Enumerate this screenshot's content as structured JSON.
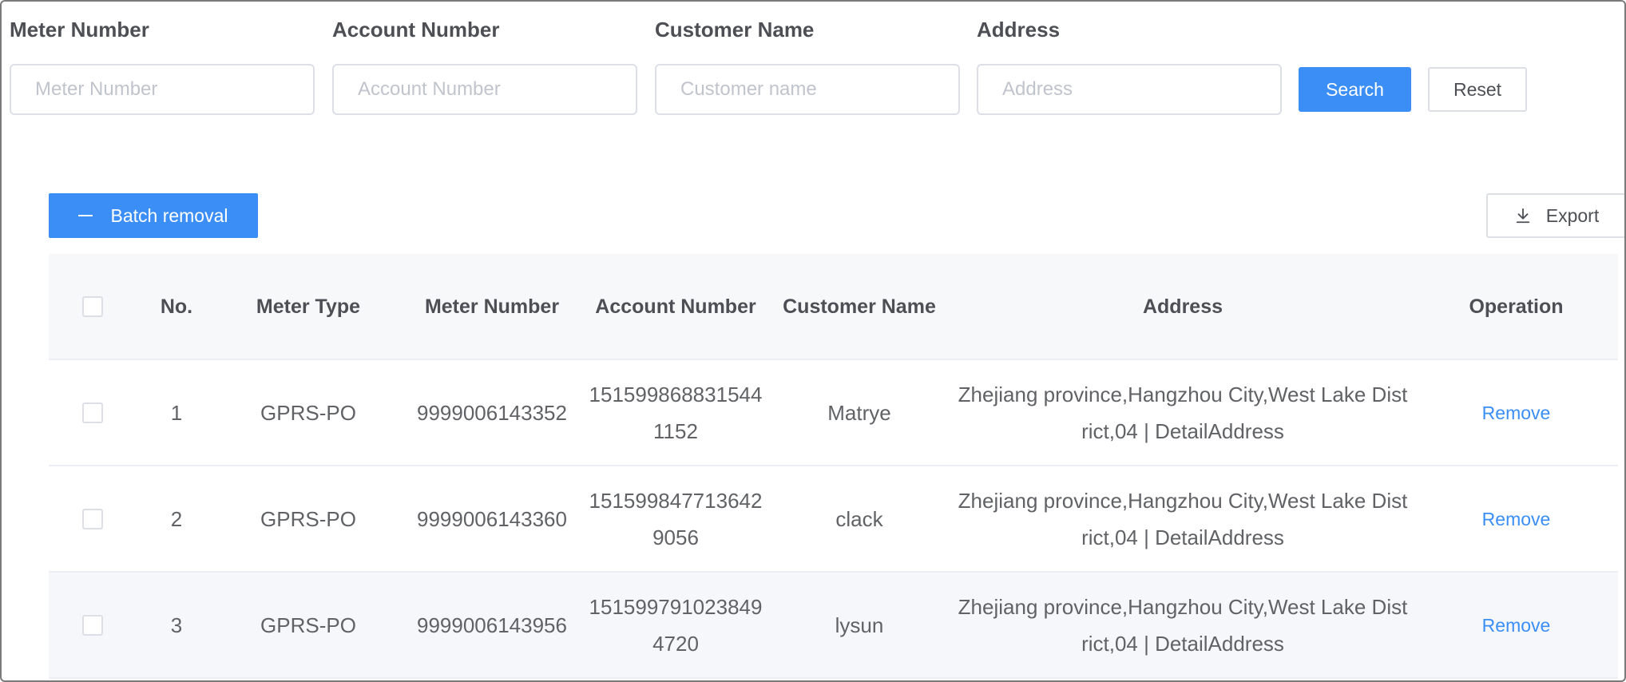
{
  "filters": [
    {
      "label": "Meter Number",
      "placeholder": "Meter Number"
    },
    {
      "label": "Account Number",
      "placeholder": "Account Number"
    },
    {
      "label": "Customer Name",
      "placeholder": "Customer name"
    },
    {
      "label": "Address",
      "placeholder": "Address"
    }
  ],
  "buttons": {
    "search": "Search",
    "reset": "Reset",
    "batch_removal": "Batch removal",
    "export": "Export"
  },
  "icons": {
    "batch_removal": "minus-icon",
    "export": "download-icon"
  },
  "colors": {
    "primary": "#3a8ef6",
    "header_bg": "#f7f8fa",
    "border": "#dcdfe6"
  },
  "table": {
    "columns": [
      "No.",
      "Meter Type",
      "Meter Number",
      "Account Number",
      "Customer Name",
      "Address",
      "Operation"
    ],
    "rows": [
      {
        "no": "1",
        "type": "GPRS-PO",
        "meter": "9999006143352",
        "account": "1515998688315441152",
        "name": "Matrye",
        "address": "Zhejiang province,Hangzhou City,West Lake District,04 | DetailAddress",
        "op": "Remove"
      },
      {
        "no": "2",
        "type": "GPRS-PO",
        "meter": "9999006143360",
        "account": "1515998477136429056",
        "name": "clack",
        "address": "Zhejiang province,Hangzhou City,West Lake District,04 | DetailAddress",
        "op": "Remove"
      },
      {
        "no": "3",
        "type": "GPRS-PO",
        "meter": "9999006143956",
        "account": "1515997910238494720",
        "name": "lysun",
        "address": "Zhejiang province,Hangzhou City,West Lake District,04 | DetailAddress",
        "op": "Remove"
      }
    ]
  }
}
